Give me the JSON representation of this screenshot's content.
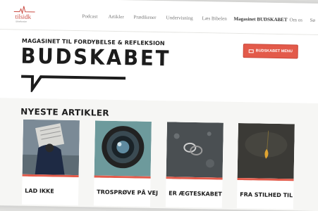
{
  "logo": {
    "word": "tilsidk",
    "sub": "Bibelforsker"
  },
  "nav": [
    {
      "label": "Podcast"
    },
    {
      "label": "Artikler"
    },
    {
      "label": "Prædikener"
    },
    {
      "label": "Undervisning"
    },
    {
      "label": "Læs Bibelen"
    },
    {
      "label": "Magasinet BUDSKABET",
      "active": true
    },
    {
      "label": "Om os"
    },
    {
      "label": "Sø"
    }
  ],
  "hero": {
    "tagline": "MAGASINET TIL FORDYBELSE & REFLEKSION",
    "title": "BUDSKABET",
    "menu_button": "BUDSKABET MENU"
  },
  "section": {
    "title": "NYESTE ARTIKLER"
  },
  "articles": [
    {
      "title": "LAD IKKE",
      "image": "person-reading-newspaper"
    },
    {
      "title": "TROSPRØVE PÅ VEJ",
      "image": "camera-lens"
    },
    {
      "title": "ER ÆGTESKABET",
      "image": "wedding-rings"
    },
    {
      "title": "FRA STILHED TIL",
      "image": "autumn-leaf"
    }
  ],
  "colors": {
    "accent": "#e35a4a",
    "text": "#1c1c1c",
    "background": "#f6f6f4"
  }
}
